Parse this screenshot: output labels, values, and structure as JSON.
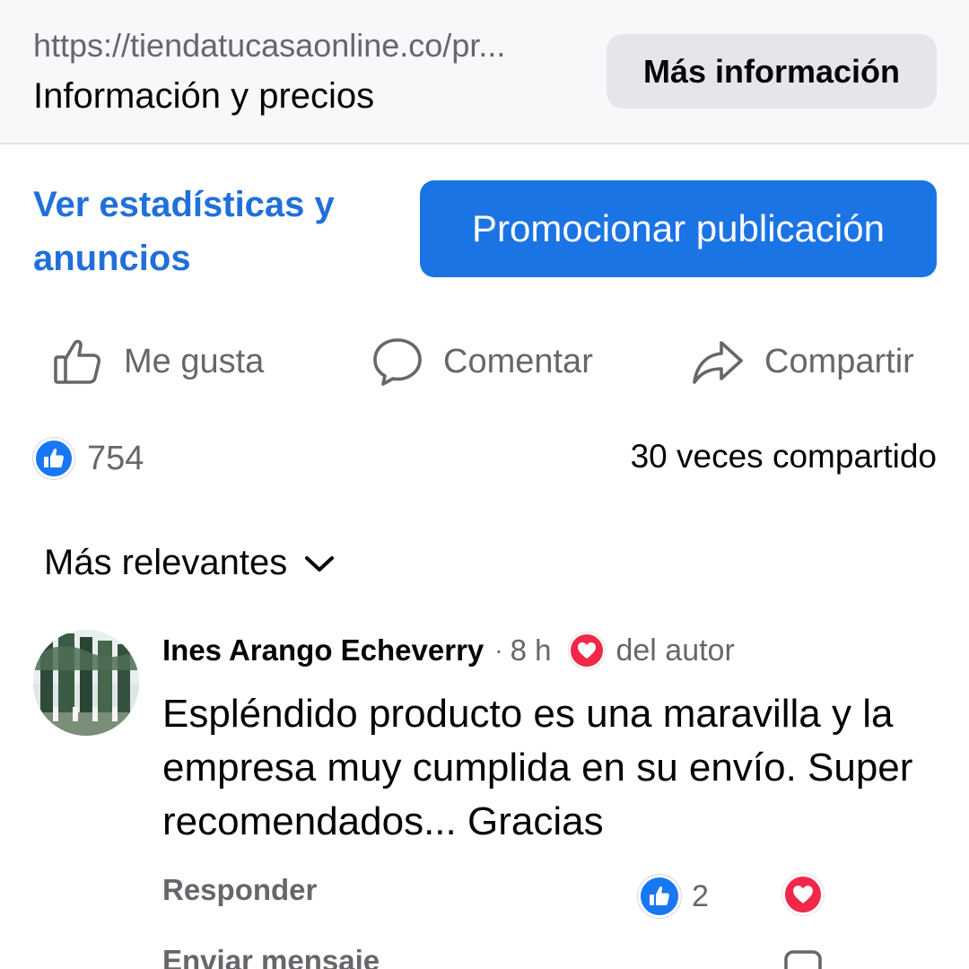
{
  "link_preview": {
    "url": "https://tiendatucasaonline.co/pr...",
    "title": "Información y precios",
    "button_label": "Más información"
  },
  "post_tools": {
    "stats_link": "Ver estadísticas y anuncios",
    "promote_button": "Promocionar publicación"
  },
  "actions": {
    "like": {
      "label": "Me gusta",
      "icon": "thumbs-up-outline-icon"
    },
    "comment": {
      "label": "Comentar",
      "icon": "speech-bubble-icon"
    },
    "share": {
      "label": "Compartir",
      "icon": "share-arrow-icon"
    }
  },
  "reactions": {
    "count": "754",
    "shares": "30 veces compartido"
  },
  "comments_sort": {
    "label": "Más relevantes",
    "icon": "chevron-down-icon"
  },
  "comment": {
    "author": "Ines Arango Echeverry",
    "separator": "·",
    "time": "8 h",
    "author_badge": "del autor",
    "text": "Espléndido producto es una maravilla y la empresa muy cumplida en su envío. Super recomendados... Gracias",
    "reply_label": "Responder",
    "like_count": "2",
    "send_message_label": "Enviar mensaje"
  },
  "colors": {
    "link_blue": "#216fdb",
    "primary_button": "#1b74e4",
    "like_blue": "#1877f2",
    "love_red": "#f02849",
    "secondary_text": "#65676b",
    "preview_background": "#f7f8fa"
  }
}
